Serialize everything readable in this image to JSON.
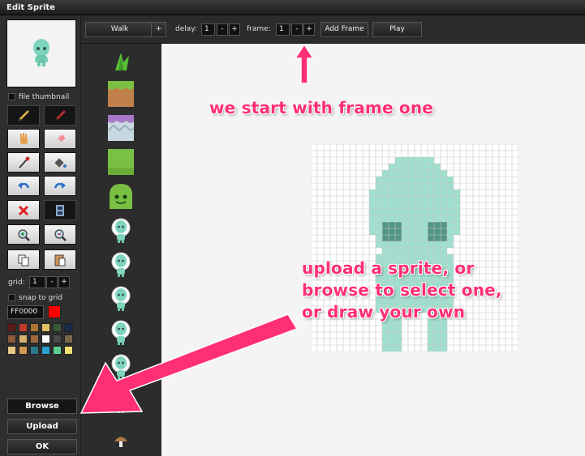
{
  "window": {
    "title": "Edit Sprite"
  },
  "left_panel": {
    "thumbnail_checkbox_label": "file thumbnail",
    "grid_label": "grid:",
    "grid_value": "1",
    "grid_minus": "-",
    "grid_plus": "+",
    "snap_label": "snap to grid",
    "color_value": "FF0000",
    "current_color": "#ff0000",
    "palette": [
      "#5a1a1a",
      "#c03a2a",
      "#a8762e",
      "#e0c060",
      "#3a5a3a",
      "#1a2a4a",
      "#8a5a3a",
      "#d8b070",
      "#a06a40",
      "#ffffff",
      "#4a4a4a",
      "#7a6a4a",
      "#e8c888",
      "#d09850",
      "#2a7a8a",
      "#2aa0d0",
      "#5ad090",
      "#f0e070"
    ],
    "tools": [
      "pencil-icon",
      "brush-icon",
      "hand-icon",
      "eraser-icon",
      "eyedropper-icon",
      "fill-icon",
      "undo-icon",
      "redo-icon",
      "delete-icon",
      "film-icon",
      "zoom-in-icon",
      "zoom-out-icon",
      "copy-icon",
      "paste-icon"
    ],
    "browse_label": "Browse",
    "upload_label": "Upload",
    "ok_label": "OK"
  },
  "toolbar": {
    "animation_name": "Walk",
    "animation_add": "+",
    "delay_label": "delay:",
    "delay_value": "1",
    "delay_minus": "-",
    "delay_plus": "+",
    "frame_label": "frame:",
    "frame_value": "1",
    "frame_minus": "-",
    "frame_plus": "+",
    "add_frame_label": "Add Frame",
    "play_label": "Play"
  },
  "sprite_strip": [
    "grass-tuft-icon",
    "dirt-block-icon",
    "crystal-block-icon",
    "grass-block-icon",
    "slime-icon",
    "alien-icon",
    "alien-icon",
    "alien-icon",
    "alien-icon",
    "alien-icon",
    "alien-icon",
    "mushroom-icon"
  ],
  "annotations": {
    "frame_note": "we start with frame one",
    "upload_note_line1": "upload a sprite, or",
    "upload_note_line2": "browse to select one,",
    "upload_note_line3": "or draw your own",
    "color": "#ff2f74"
  },
  "canvas": {
    "grid_cells": 32,
    "sprite_color": "#7fd4bd"
  }
}
